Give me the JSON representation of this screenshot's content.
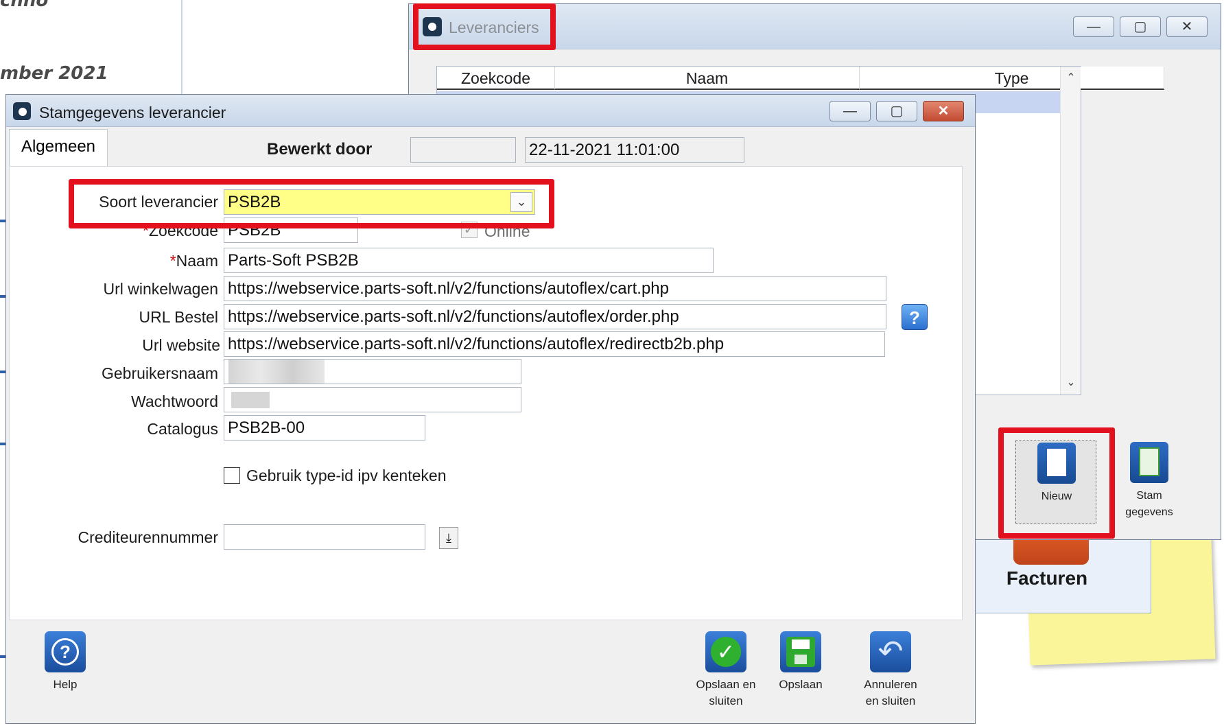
{
  "background": {
    "text_top": "cnno",
    "text_month": "mber 2021",
    "facturen_label": "Facturen",
    "sticky_note_color": "#fbf59a"
  },
  "leveranciers": {
    "title": "Leveranciers",
    "columns": [
      "Zoekcode",
      "Naam",
      "Type"
    ],
    "toolbar": {
      "nieuw_label": "Nieuw",
      "stam_label_1": "Stam",
      "stam_label_2": "gegevens"
    }
  },
  "stam": {
    "title": "Stamgegevens leverancier",
    "tab_algemeen": "Algemeen",
    "bewerkt_door_label": "Bewerkt door",
    "bewerkt_door_value": "",
    "timestamp": "22-11-2021 11:01:00",
    "fields": {
      "soort_label": "Soort leverancier",
      "soort_value": "PSB2B",
      "zoekcode_label": "Zoekcode",
      "zoekcode_value": "PSB2B",
      "online_label": "Online",
      "naam_label": "Naam",
      "naam_value": "Parts-Soft PSB2B",
      "url_winkelwagen_label": "Url winkelwagen",
      "url_winkelwagen_value": "https://webservice.parts-soft.nl/v2/functions/autoflex/cart.php",
      "url_bestel_label": "URL Bestel",
      "url_bestel_value": "https://webservice.parts-soft.nl/v2/functions/autoflex/order.php",
      "url_website_label": "Url website",
      "url_website_value": "https://webservice.parts-soft.nl/v2/functions/autoflex/redirectb2b.php",
      "gebruikersnaam_label": "Gebruikersnaam",
      "wachtwoord_label": "Wachtwoord",
      "catalogus_label": "Catalogus",
      "catalogus_value": "PSB2B-00",
      "type_id_label": "Gebruik type-id ipv kenteken",
      "crediteur_label": "Crediteurennummer",
      "crediteur_value": ""
    },
    "buttons": {
      "help": "Help",
      "opslaan_sluiten_1": "Opslaan en",
      "opslaan_sluiten_2": "sluiten",
      "opslaan": "Opslaan",
      "annuleren_1": "Annuleren",
      "annuleren_2": "en sluiten"
    }
  },
  "colors": {
    "highlight_red": "#e3101d",
    "select_yellow": "#ffff88",
    "selection_blue": "#c7d5f3"
  }
}
